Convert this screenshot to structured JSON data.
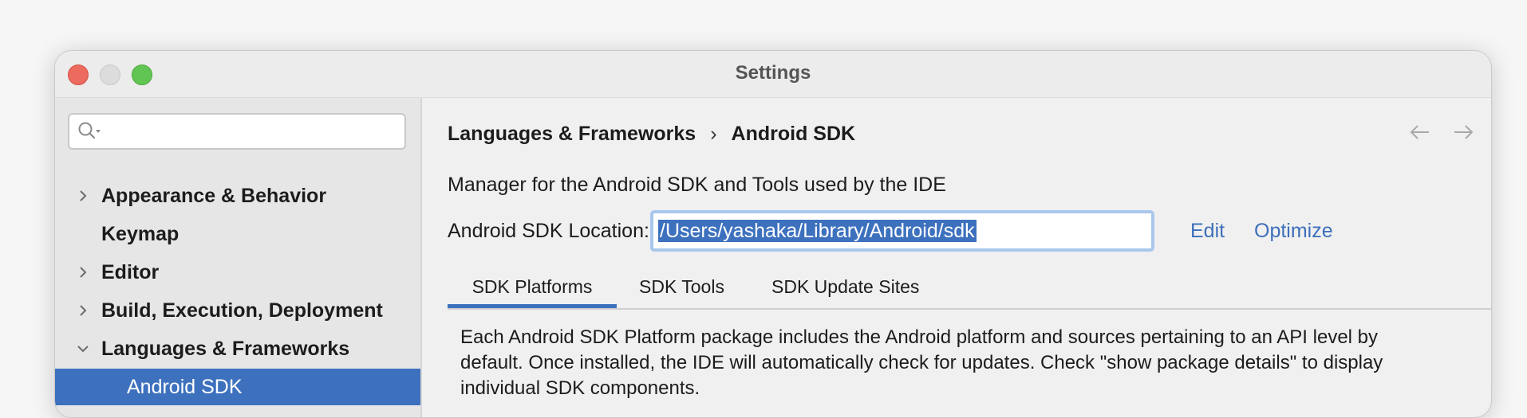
{
  "window": {
    "title": "Settings"
  },
  "sidebar": {
    "search_placeholder": "",
    "items": [
      {
        "label": "Appearance & Behavior",
        "chevron": "right"
      },
      {
        "label": "Keymap",
        "chevron": ""
      },
      {
        "label": "Editor",
        "chevron": "right"
      },
      {
        "label": "Build, Execution, Deployment",
        "chevron": "right"
      },
      {
        "label": "Languages & Frameworks",
        "chevron": "down"
      },
      {
        "label": "Android SDK",
        "selected": true
      }
    ]
  },
  "main": {
    "breadcrumb": [
      "Languages & Frameworks",
      "Android SDK"
    ],
    "breadcrumb_sep": "›",
    "description": "Manager for the Android SDK and Tools used by the IDE",
    "location_label": "Android SDK Location:",
    "location_value": "/Users/yashaka/Library/Android/sdk",
    "edit_label": "Edit",
    "optimize_label": "Optimize",
    "tabs": [
      "SDK Platforms",
      "SDK Tools",
      "SDK Update Sites"
    ],
    "active_tab": "SDK Platforms",
    "panel_text": "Each Android SDK Platform package includes the Android platform and sources pertaining to an API level by default. Once installed, the IDE will automatically check for updates. Check \"show package details\" to display individual SDK components."
  },
  "colors": {
    "accent": "#3d71be",
    "link": "#3d6fbb",
    "close": "#ec6a5e",
    "maximize": "#61c554"
  }
}
